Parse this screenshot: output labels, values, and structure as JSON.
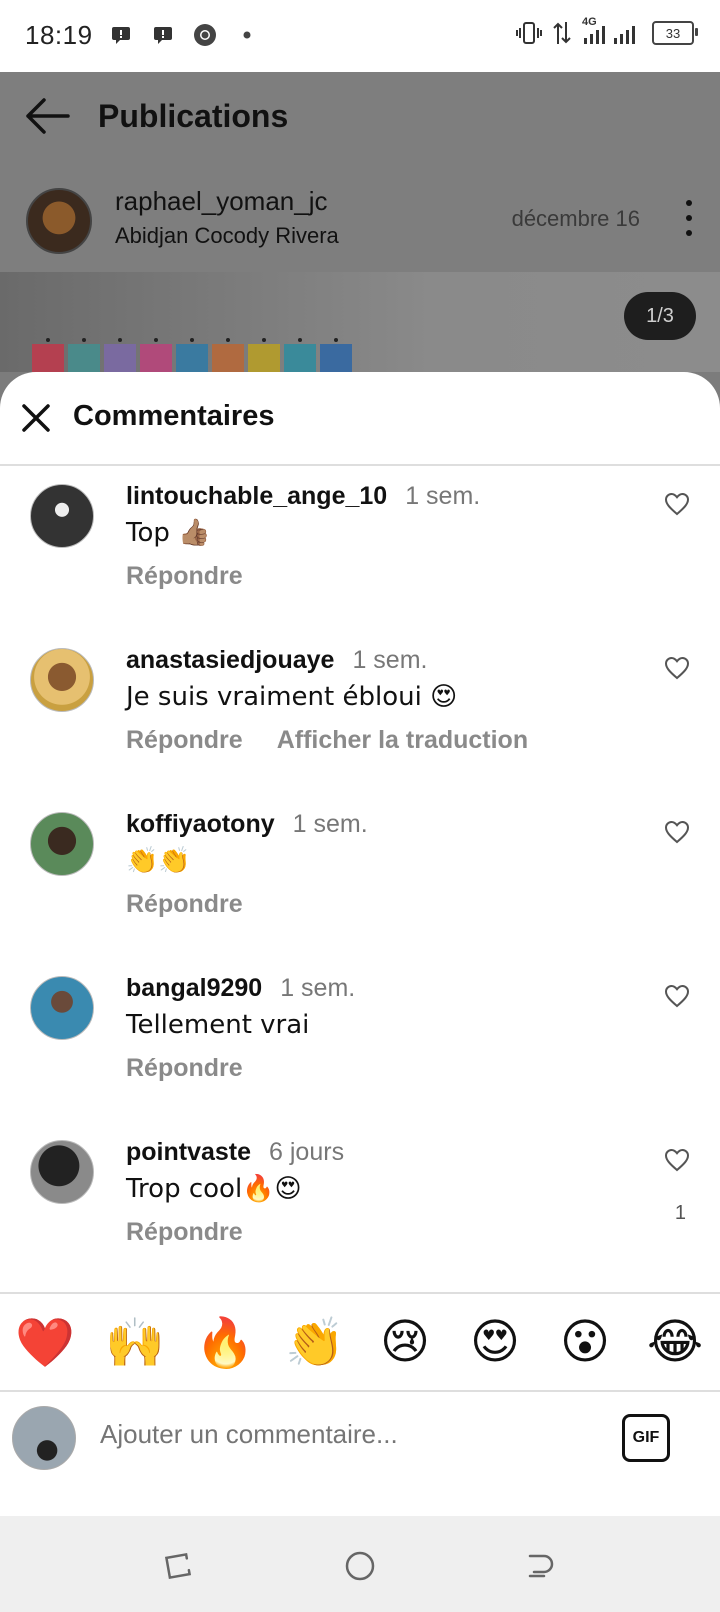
{
  "status_bar": {
    "time": "18:19",
    "network": "4G",
    "battery": "33"
  },
  "header": {
    "title": "Publications"
  },
  "post": {
    "username": "raphael_yoman_jc",
    "location": "Abidjan Cocody Rivera",
    "date": "décembre 16",
    "counter": "1/3"
  },
  "sheet": {
    "title": "Commentaires"
  },
  "comments": [
    {
      "username": "lintouchable_ange_10",
      "time": "1 sem.",
      "text": "Top 👍🏽",
      "actions": [
        "Répondre"
      ],
      "likes": ""
    },
    {
      "username": "anastasiedjouaye",
      "time": "1 sem.",
      "text": "Je suis vraiment ébloui 😍",
      "actions": [
        "Répondre",
        "Afficher la traduction"
      ],
      "likes": ""
    },
    {
      "username": "koffiyaotony",
      "time": "1 sem.",
      "text": "👏👏",
      "actions": [
        "Répondre"
      ],
      "likes": ""
    },
    {
      "username": "bangal9290",
      "time": "1 sem.",
      "text": "Tellement vrai",
      "actions": [
        "Répondre"
      ],
      "likes": ""
    },
    {
      "username": "pointvaste",
      "time": "6 jours",
      "text": "Trop cool🔥😍",
      "actions": [
        "Répondre"
      ],
      "likes": "1"
    }
  ],
  "reactions": [
    "❤️",
    "🙌",
    "🔥",
    "👏",
    "😢",
    "😍",
    "😮",
    "😂"
  ],
  "composer": {
    "placeholder": "Ajouter un commentaire...",
    "gif_label": "GIF"
  }
}
